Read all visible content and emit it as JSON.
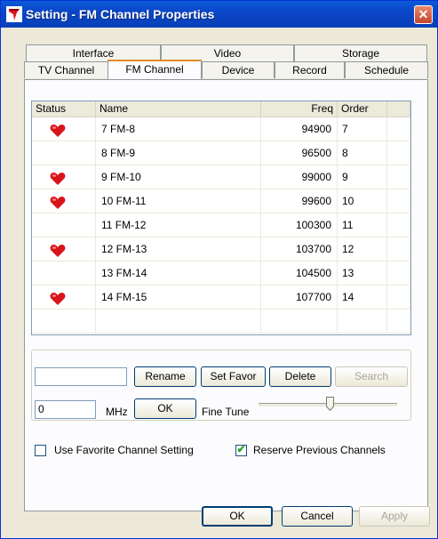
{
  "window": {
    "title": "Setting - FM Channel Properties"
  },
  "tabs": {
    "top_row": [
      "Interface",
      "Video",
      "Storage"
    ],
    "bottom_row": [
      "TV Channel",
      "FM Channel",
      "Device",
      "Record",
      "Schedule"
    ],
    "active": "FM Channel"
  },
  "list": {
    "headers": {
      "status": "Status",
      "name": "Name",
      "freq": "Freq",
      "order": "Order"
    },
    "rows": [
      {
        "favorite": true,
        "name": "7  FM-8",
        "freq": "94900",
        "order": "7"
      },
      {
        "favorite": false,
        "name": "8  FM-9",
        "freq": "96500",
        "order": "8"
      },
      {
        "favorite": true,
        "name": "9  FM-10",
        "freq": "99000",
        "order": "9"
      },
      {
        "favorite": true,
        "name": "10 FM-11",
        "freq": "99600",
        "order": "10"
      },
      {
        "favorite": false,
        "name": "11 FM-12",
        "freq": "100300",
        "order": "11"
      },
      {
        "favorite": true,
        "name": "12 FM-13",
        "freq": "103700",
        "order": "12"
      },
      {
        "favorite": false,
        "name": "13 FM-14",
        "freq": "104500",
        "order": "13"
      },
      {
        "favorite": true,
        "name": "14 FM-15",
        "freq": "107700",
        "order": "14"
      }
    ]
  },
  "controls": {
    "name_input_value": "",
    "rename_label": "Rename",
    "set_favor_label": "Set Favor",
    "delete_label": "Delete",
    "search_label": "Search",
    "freq_input_value": "0",
    "mhz_label": "MHz",
    "ok_small_label": "OK",
    "fine_tune_label": "Fine Tune"
  },
  "options": {
    "use_favorite_label": "Use Favorite Channel Setting",
    "use_favorite_checked": false,
    "reserve_previous_label": "Reserve Previous Channels",
    "reserve_previous_checked": true
  },
  "footer": {
    "ok_label": "OK",
    "cancel_label": "Cancel",
    "apply_label": "Apply"
  },
  "colors": {
    "title_bar": "#0a4fd0",
    "heart": "#d8141a",
    "tab_accent": "#e68b2c"
  }
}
